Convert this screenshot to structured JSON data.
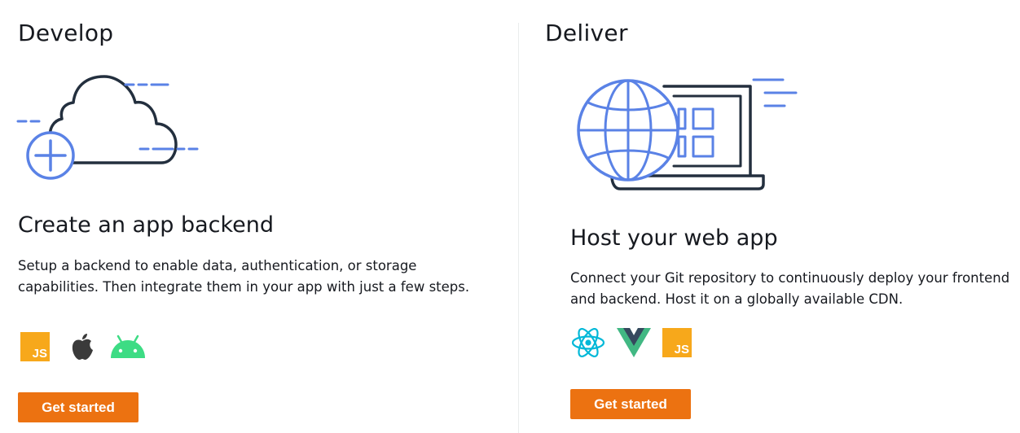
{
  "develop": {
    "section_title": "Develop",
    "card_title": "Create an app backend",
    "description": "Setup a backend to enable data, authentication, or storage capabilities. Then integrate them in your app with just a few steps.",
    "platforms": [
      {
        "icon": "javascript-icon",
        "label": "JS"
      },
      {
        "icon": "apple-icon"
      },
      {
        "icon": "android-icon"
      }
    ],
    "button_label": "Get started"
  },
  "deliver": {
    "section_title": "Deliver",
    "card_title": "Host your web app",
    "description": "Connect your Git repository to continuously deploy your frontend and backend. Host it on a globally available CDN.",
    "platforms": [
      {
        "icon": "react-icon"
      },
      {
        "icon": "vue-icon"
      },
      {
        "icon": "javascript-icon",
        "label": "JS"
      }
    ],
    "button_label": "Get started"
  },
  "colors": {
    "accent_orange": "#ec7211",
    "illustration_blue": "#5a82e6",
    "illustration_dark": "#232f3e",
    "js_yellow": "#f7a81b",
    "android_green": "#3ddc84",
    "react_cyan": "#00b8d8",
    "vue_green": "#41b883",
    "vue_dark": "#35495e"
  }
}
